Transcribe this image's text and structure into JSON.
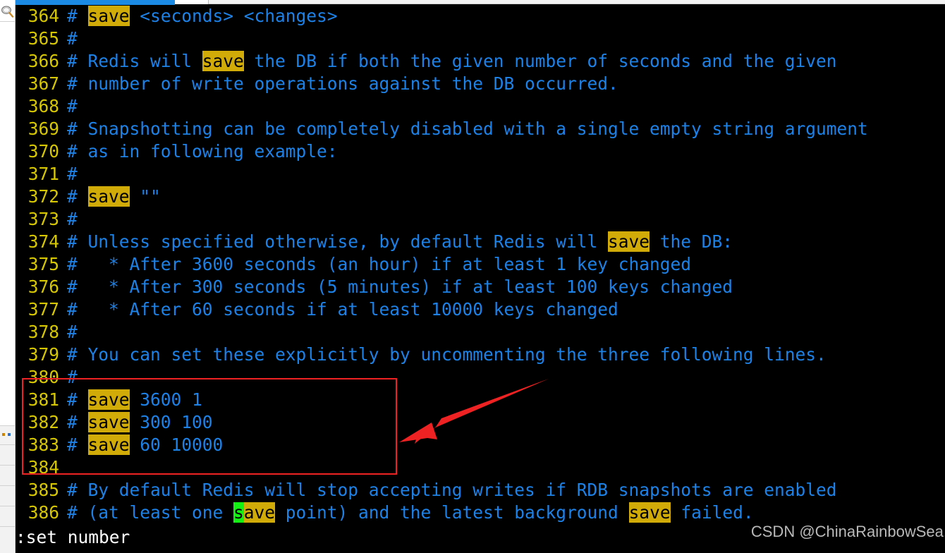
{
  "window": {
    "left_strip": {
      "search_icon": "search-icon",
      "divider_count": 6
    },
    "top_bar": {
      "active_tab_color": "#1a8ae5"
    }
  },
  "terminal": {
    "background": "#000000",
    "line_number_color": "#d6c700",
    "text_color": "#1d82e8",
    "highlight_bg": "#d1ab08",
    "cursor_bg": "#14ef14",
    "lines": [
      {
        "num": "364",
        "segments": [
          {
            "t": "# ",
            "k": "tx"
          },
          {
            "t": "save",
            "k": "hl"
          },
          {
            "t": " <seconds> <changes>",
            "k": "tx"
          }
        ]
      },
      {
        "num": "365",
        "segments": [
          {
            "t": "#",
            "k": "tx"
          }
        ]
      },
      {
        "num": "366",
        "segments": [
          {
            "t": "# Redis will ",
            "k": "tx"
          },
          {
            "t": "save",
            "k": "hl"
          },
          {
            "t": " the DB if both the given number of seconds and the given",
            "k": "tx"
          }
        ]
      },
      {
        "num": "367",
        "segments": [
          {
            "t": "# number of write operations against the DB occurred.",
            "k": "tx"
          }
        ]
      },
      {
        "num": "368",
        "segments": [
          {
            "t": "#",
            "k": "tx"
          }
        ]
      },
      {
        "num": "369",
        "segments": [
          {
            "t": "# Snapshotting can be completely disabled with a single empty string argument",
            "k": "tx"
          }
        ]
      },
      {
        "num": "370",
        "segments": [
          {
            "t": "# as in following example:",
            "k": "tx"
          }
        ]
      },
      {
        "num": "371",
        "segments": [
          {
            "t": "#",
            "k": "tx"
          }
        ]
      },
      {
        "num": "372",
        "segments": [
          {
            "t": "# ",
            "k": "tx"
          },
          {
            "t": "save",
            "k": "hl"
          },
          {
            "t": " \"\"",
            "k": "tx"
          }
        ]
      },
      {
        "num": "373",
        "segments": [
          {
            "t": "#",
            "k": "tx"
          }
        ]
      },
      {
        "num": "374",
        "segments": [
          {
            "t": "# Unless specified otherwise, by default Redis will ",
            "k": "tx"
          },
          {
            "t": "save",
            "k": "hl"
          },
          {
            "t": " the DB:",
            "k": "tx"
          }
        ]
      },
      {
        "num": "375",
        "segments": [
          {
            "t": "#   * After 3600 seconds (an hour) if at least 1 key changed",
            "k": "tx"
          }
        ]
      },
      {
        "num": "376",
        "segments": [
          {
            "t": "#   * After 300 seconds (5 minutes) if at least 100 keys changed",
            "k": "tx"
          }
        ]
      },
      {
        "num": "377",
        "segments": [
          {
            "t": "#   * After 60 seconds if at least 10000 keys changed",
            "k": "tx"
          }
        ]
      },
      {
        "num": "378",
        "segments": [
          {
            "t": "#",
            "k": "tx"
          }
        ]
      },
      {
        "num": "379",
        "segments": [
          {
            "t": "# You can set these explicitly by uncommenting the three following lines.",
            "k": "tx"
          }
        ]
      },
      {
        "num": "380",
        "segments": [
          {
            "t": "#",
            "k": "tx"
          }
        ]
      },
      {
        "num": "381",
        "segments": [
          {
            "t": "# ",
            "k": "tx"
          },
          {
            "t": "save",
            "k": "hl"
          },
          {
            "t": " 3600 1",
            "k": "tx"
          }
        ]
      },
      {
        "num": "382",
        "segments": [
          {
            "t": "# ",
            "k": "tx"
          },
          {
            "t": "save",
            "k": "hl"
          },
          {
            "t": " 300 100",
            "k": "tx"
          }
        ]
      },
      {
        "num": "383",
        "segments": [
          {
            "t": "# ",
            "k": "tx"
          },
          {
            "t": "save",
            "k": "hl"
          },
          {
            "t": " 60 10000",
            "k": "tx"
          }
        ]
      },
      {
        "num": "384",
        "segments": [
          {
            "t": "",
            "k": "tx"
          }
        ]
      },
      {
        "num": "385",
        "segments": [
          {
            "t": "# By default Redis will stop accepting writes if RDB snapshots are enabled",
            "k": "tx"
          }
        ]
      },
      {
        "num": "386",
        "segments": [
          {
            "t": "# (at least one ",
            "k": "tx"
          },
          {
            "t": "s",
            "k": "cur"
          },
          {
            "t": "ave",
            "k": "hl"
          },
          {
            "t": " point) and the latest background ",
            "k": "tx"
          },
          {
            "t": "save",
            "k": "hl"
          },
          {
            "t": " failed.",
            "k": "tx"
          }
        ]
      }
    ]
  },
  "status": {
    "command_text": ":set number"
  },
  "watermark": {
    "text": "CSDN @ChinaRainbowSea."
  },
  "annotations": {
    "red_box": {
      "color": "#ee2222",
      "covers_lines": [
        "380",
        "381",
        "382",
        "383",
        "384"
      ]
    },
    "red_arrow": {
      "color": "#ee2222",
      "direction": "points-left-down-to-red-box"
    }
  }
}
